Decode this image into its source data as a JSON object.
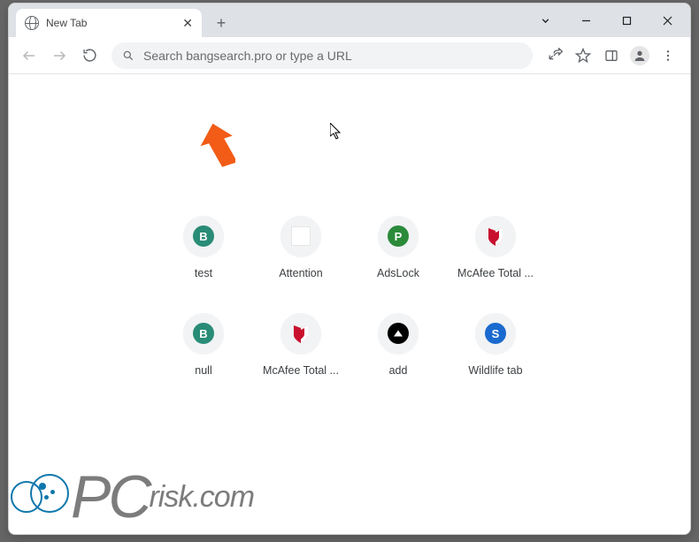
{
  "tab": {
    "title": "New Tab"
  },
  "omnibox": {
    "placeholder": "Search bangsearch.pro or type a URL"
  },
  "shortcuts": [
    {
      "label": "test",
      "icon": "letter-b"
    },
    {
      "label": "Attention",
      "icon": "square"
    },
    {
      "label": "AdsLock",
      "icon": "letter-p"
    },
    {
      "label": "McAfee Total ...",
      "icon": "mcafee"
    },
    {
      "label": "null",
      "icon": "letter-b"
    },
    {
      "label": "McAfee Total ...",
      "icon": "mcafee"
    },
    {
      "label": "add",
      "icon": "triangle"
    },
    {
      "label": "Wildlife tab",
      "icon": "letter-s"
    }
  ],
  "watermark": {
    "brand_main": "PC",
    "brand_sub": "risk.com"
  }
}
